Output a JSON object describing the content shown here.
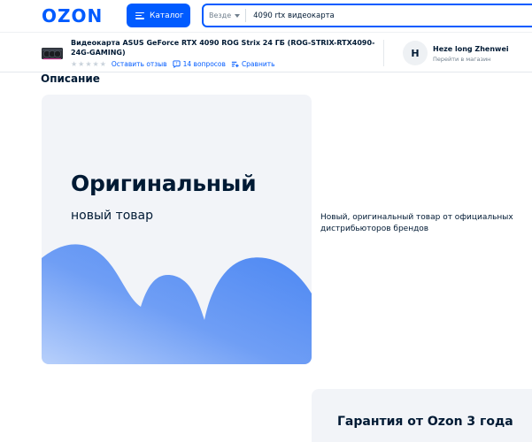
{
  "header": {
    "logo": "OZON",
    "catalog_label": "Каталог",
    "search": {
      "scope": "Везде",
      "query": "4090 rtx видеокарта"
    }
  },
  "product_bar": {
    "title": "Видеокарта ASUS GeForce RTX 4090 ROG Strix 24 ГБ (ROG-STRIX-RTX4090-24G-GAMING)",
    "review_link": "Оставить отзыв",
    "questions_link": "14 вопросов",
    "compare_link": "Сравнить",
    "rating_stars": 0,
    "seller": {
      "avatar_letter": "H",
      "name": "Heze long Zhenwei",
      "link": "Перейти в магазин"
    }
  },
  "description": {
    "heading": "Описание",
    "promo": {
      "big_text": "Оригинальный",
      "sub_text": "новый товар"
    },
    "text": "Новый, оригинальный товар от официальных дистрибьюторов брендов"
  },
  "guarantee": {
    "title": "Гарантия от Ozon 3 года"
  },
  "colors": {
    "brand_blue": "#005bff",
    "text_dark": "#001a34",
    "card_bg": "#f2f4f8"
  },
  "icons": [
    "catalog-menu-icon",
    "chevron-down-icon",
    "star-icon",
    "question-bubble-icon",
    "compare-icon",
    "product-thumbnail"
  ]
}
